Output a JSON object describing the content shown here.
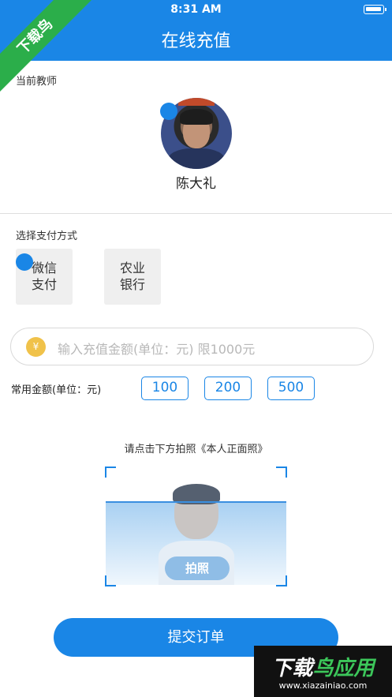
{
  "status_bar": {
    "time": "8:31 AM"
  },
  "header": {
    "title": "在线充值"
  },
  "teacher": {
    "section_label": "当前教师",
    "name": "陈大礼"
  },
  "payment": {
    "section_label": "选择支付方式",
    "methods": [
      {
        "line1": "微信",
        "line2": "支付"
      },
      {
        "line1": "农业",
        "line2": "银行"
      }
    ]
  },
  "amount": {
    "currency_symbol": "¥",
    "placeholder": "输入充值金额(单位：元) 限1000元",
    "common_label": "常用金额(单位：元)",
    "presets": [
      "100",
      "200",
      "500"
    ]
  },
  "photo": {
    "hint": "请点击下方拍照《本人正面照》",
    "button_label": "拍照"
  },
  "submit": {
    "label": "提交订单"
  },
  "watermarks": {
    "corner_text": "下载鸟",
    "bottom_title_a": "下载",
    "bottom_title_b": "鸟应用",
    "bottom_url": "www.xiazainiao.com"
  },
  "colors": {
    "primary": "#1a86e6",
    "accent_yellow": "#f0c24a",
    "watermark_green": "#2bae4a"
  }
}
